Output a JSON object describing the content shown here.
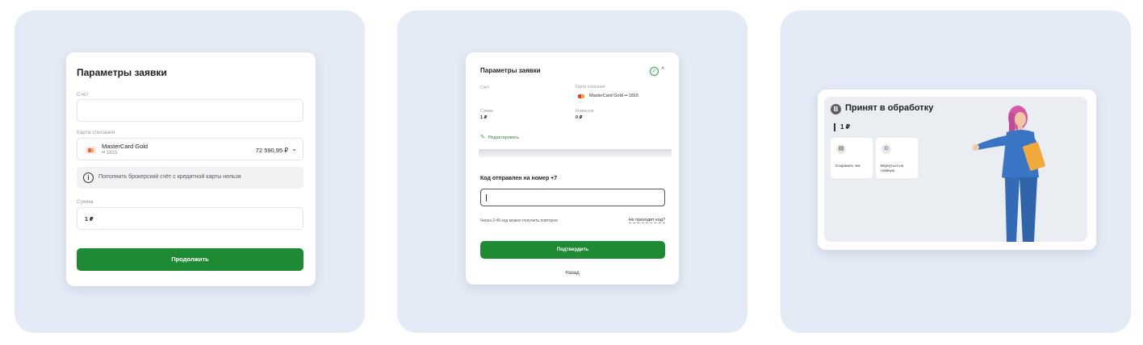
{
  "panel1": {
    "title": "Параметры заявки",
    "account_label": "Счёт",
    "account_value": "",
    "card_label": "Карта списания",
    "card_name": "MasterCard Gold",
    "card_mask": "•• 1815",
    "card_balance": "72 590,95 ₽",
    "info_text": "Пополнить брокерский счёт с кредитной карты нельзя",
    "sum_label": "Сумма",
    "sum_value": "1 ₽",
    "continue_label": "Продолжить"
  },
  "panel2": {
    "title": "Параметры заявки",
    "account_label": "Счёт",
    "card_label": "Карта списания",
    "card_name": "MasterCard Gold •• 1815",
    "sum_label": "Сумма",
    "sum_value": "1 ₽",
    "fee_label": "Комиссия",
    "fee_value": "0 ₽",
    "edit_label": "Редактировать",
    "code_title": "Код отправлен на номер +7",
    "resend_text": "Через 2:45 код можно получить повторно",
    "no_code_link": "Не приходит код?",
    "confirm_label": "Подтвердить",
    "back_label": "Назад"
  },
  "panel3": {
    "badge": "В",
    "title": "Принят в обработку",
    "amount": "1 ₽",
    "tiles": [
      {
        "label": "Сохранить чек",
        "icon": "receipt-icon"
      },
      {
        "label": "Вернуться на главную",
        "icon": "home-check-icon"
      }
    ]
  },
  "colors": {
    "panel_bg": "#e4ebf6",
    "accent_green": "#1e8a34",
    "figure_suit": "#3a74c4",
    "figure_hair": "#d45aa8",
    "folder": "#f0a93a"
  }
}
